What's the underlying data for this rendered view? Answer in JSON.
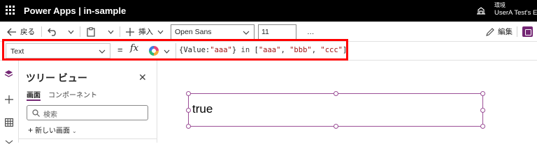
{
  "topbar": {
    "app_title": "Power Apps  |  in-sample",
    "env_label": "環境",
    "env_name": "UserA Test's E"
  },
  "commandbar": {
    "back_label": "戻る",
    "insert_label": "挿入",
    "font": "Open Sans",
    "font_size": "11",
    "more": "…",
    "edit_label": "編集"
  },
  "formulabar": {
    "property": "Text",
    "equals": "=",
    "fx": "fx",
    "formula": {
      "open": "{Value:",
      "value": "\"aaa\"",
      "close": "} ",
      "in": "in",
      "list_open": " [",
      "items": [
        "\"aaa\"",
        "\"bbb\"",
        "\"ccc\""
      ],
      "list_close": "]"
    }
  },
  "tree": {
    "title": "ツリー ビュー",
    "close": "✕",
    "tabs": [
      "画面",
      "コンポーネント"
    ],
    "search_placeholder": "検索",
    "new_screen": "新しい画面"
  },
  "canvas": {
    "label_text": "true"
  },
  "colors": {
    "accent": "#742774",
    "selection": "#9b4f96",
    "highlight": "#ff0000",
    "string": "#a31515"
  }
}
